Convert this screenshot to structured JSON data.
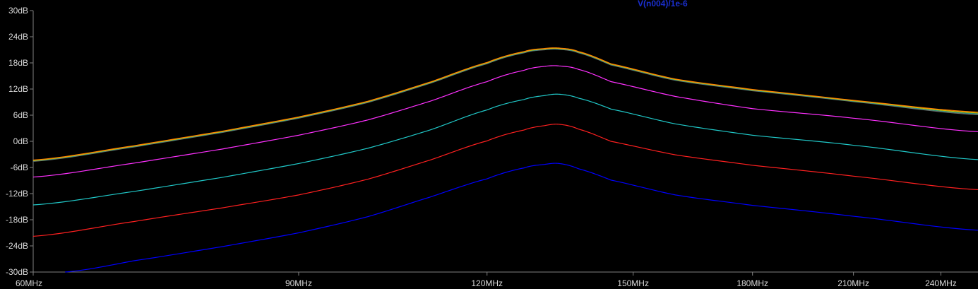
{
  "chart_data": {
    "type": "line",
    "title": "V(n004)/1e-6",
    "title_color": "#1a2fd0",
    "background": "#000000",
    "axis_color": "#808080",
    "tick_label_color": "#d8d8d8",
    "x_scale": "log",
    "xlim_mhz": [
      60,
      254
    ],
    "ylim_db": [
      -30,
      30
    ],
    "y_ticks": [
      30,
      24,
      18,
      12,
      6,
      0,
      -6,
      -12,
      -18,
      -24,
      -30
    ],
    "y_tick_labels": [
      "30dB",
      "24dB",
      "18dB",
      "12dB",
      "6dB",
      "0dB",
      "-6dB",
      "-12dB",
      "-18dB",
      "-24dB",
      "-30dB"
    ],
    "x_ticks_mhz": [
      60,
      90,
      120,
      150,
      180,
      210,
      240
    ],
    "x_tick_labels": [
      "60MHz",
      "90MHz",
      "120MHz",
      "150MHz",
      "180MHz",
      "210MHz",
      "240MHz"
    ],
    "series": [
      {
        "color": "#0000ff",
        "x": [
          63,
          70,
          80,
          90,
          100,
          110,
          120,
          127,
          131,
          134,
          138,
          145,
          160,
          180,
          210,
          254
        ],
        "y": [
          -30,
          -27.4,
          -24.2,
          -21.0,
          -17.3,
          -12.8,
          -8.6,
          -6.1,
          -5.3,
          -5.1,
          -6.3,
          -8.9,
          -12.3,
          -14.7,
          -17.2,
          -20.4
        ]
      },
      {
        "color": "#ff2020",
        "x": [
          60,
          70,
          80,
          90,
          100,
          110,
          120,
          127,
          131,
          134,
          138,
          145,
          160,
          180,
          210,
          254
        ],
        "y": [
          -21.8,
          -18.4,
          -15.3,
          -12.3,
          -8.7,
          -4.3,
          0.1,
          2.6,
          3.6,
          3.9,
          2.8,
          0.0,
          -3.1,
          -5.5,
          -8.0,
          -11.1
        ]
      },
      {
        "color": "#20c8c8",
        "x": [
          60,
          70,
          80,
          90,
          100,
          110,
          120,
          127,
          131,
          134,
          138,
          145,
          160,
          180,
          210,
          254
        ],
        "y": [
          -14.6,
          -11.5,
          -8.3,
          -5.1,
          -1.6,
          2.6,
          7.2,
          9.6,
          10.5,
          10.8,
          9.9,
          7.4,
          4.0,
          1.4,
          -0.9,
          -4.2
        ]
      },
      {
        "color": "#ff30ff",
        "x": [
          60,
          70,
          80,
          90,
          100,
          110,
          120,
          127,
          131,
          134,
          138,
          145,
          160,
          180,
          210,
          254
        ],
        "y": [
          -8.2,
          -5.0,
          -1.8,
          1.4,
          4.9,
          9.2,
          13.7,
          16.3,
          17.2,
          17.3,
          16.5,
          13.7,
          10.3,
          7.5,
          5.3,
          2.2
        ]
      },
      {
        "color": "#6a6a6a",
        "x": [
          60,
          70,
          80,
          90,
          100,
          110,
          120,
          127,
          131,
          134,
          138,
          145,
          160,
          180,
          210,
          254
        ],
        "y": [
          -4.6,
          -1.3,
          2.0,
          5.3,
          8.9,
          13.3,
          17.8,
          20.3,
          21.0,
          21.1,
          20.3,
          17.5,
          14.0,
          11.6,
          9.1,
          6.1
        ]
      },
      {
        "color": "#2a9a8a",
        "x": [
          60,
          70,
          80,
          90,
          100,
          110,
          120,
          127,
          131,
          134,
          138,
          145,
          160,
          180,
          210,
          254
        ],
        "y": [
          -4.5,
          -1.2,
          2.1,
          5.4,
          9.0,
          13.4,
          17.9,
          20.4,
          21.1,
          21.2,
          20.4,
          17.6,
          14.1,
          11.7,
          9.2,
          6.3
        ]
      },
      {
        "color": "#d0c000",
        "x": [
          60,
          70,
          80,
          90,
          100,
          110,
          120,
          127,
          131,
          134,
          138,
          145,
          160,
          180,
          210,
          254
        ],
        "y": [
          -4.4,
          -1.1,
          2.2,
          5.5,
          9.1,
          13.5,
          18.0,
          20.5,
          21.2,
          21.3,
          20.5,
          17.7,
          14.2,
          11.8,
          9.3,
          6.5
        ]
      },
      {
        "color": "#ff8000",
        "x": [
          60,
          70,
          80,
          90,
          100,
          110,
          120,
          127,
          131,
          134,
          138,
          145,
          160,
          180,
          210,
          254
        ],
        "y": [
          -4.3,
          -1.0,
          2.3,
          5.6,
          9.2,
          13.6,
          18.1,
          20.6,
          21.3,
          21.4,
          20.6,
          17.8,
          14.3,
          11.9,
          9.4,
          6.7
        ]
      }
    ]
  }
}
